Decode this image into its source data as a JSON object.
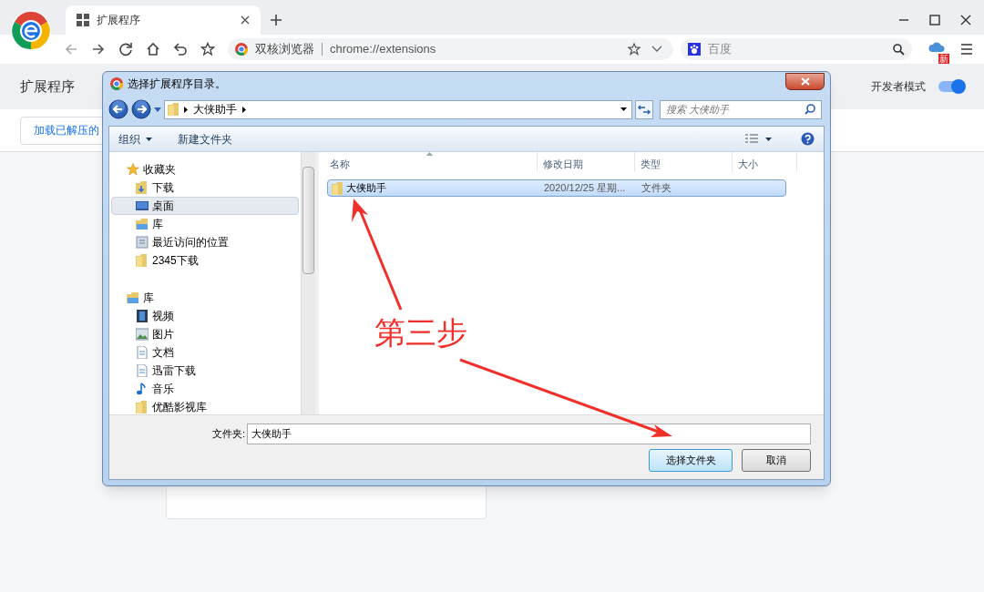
{
  "browser": {
    "tab": {
      "title": "扩展程序",
      "selected": true
    },
    "address": {
      "site_label": "双核浏览器",
      "url": "chrome://extensions"
    },
    "search": {
      "placeholder": "百度"
    },
    "extension_badge": "新"
  },
  "page": {
    "title": "扩展程序",
    "developer_mode": {
      "label": "开发者模式",
      "on": true
    },
    "load_button": "加载已解压的"
  },
  "dialog": {
    "title": "选择扩展程序目录。",
    "breadcrumb": [
      "大侠助手"
    ],
    "search": {
      "placeholder": "搜索 大侠助手"
    },
    "toolbar": [
      {
        "label": "组织",
        "kind": "menu"
      },
      {
        "label": "新建文件夹",
        "kind": "button"
      }
    ],
    "nav": [
      {
        "label": "收藏夹",
        "kind": "star",
        "selected": false,
        "children": [
          {
            "label": "下载",
            "kind": "download",
            "selected": false
          },
          {
            "label": "桌面",
            "kind": "desktop",
            "selected": true
          },
          {
            "label": "库",
            "kind": "library",
            "selected": false
          },
          {
            "label": "最近访问的位置",
            "kind": "recent",
            "selected": false
          },
          {
            "label": "2345下载",
            "kind": "folder",
            "selected": false
          }
        ]
      },
      {
        "label": "库",
        "kind": "library",
        "selected": false,
        "children": [
          {
            "label": "视频",
            "kind": "video",
            "selected": false
          },
          {
            "label": "图片",
            "kind": "picture",
            "selected": false
          },
          {
            "label": "文档",
            "kind": "document",
            "selected": false
          },
          {
            "label": "迅雷下载",
            "kind": "document",
            "selected": false
          },
          {
            "label": "音乐",
            "kind": "music",
            "selected": false
          },
          {
            "label": "优酷影视库",
            "kind": "folder",
            "selected": false
          }
        ]
      }
    ],
    "columns": [
      "名称",
      "修改日期",
      "类型",
      "大小"
    ],
    "rows": [
      {
        "cells": [
          "大侠助手",
          "2020/12/25 星期...",
          "文件夹"
        ],
        "selected": true
      }
    ],
    "folder_label": "文件夹:",
    "folder_value": "大侠助手",
    "buttons": [
      {
        "label": "选择文件夹",
        "kind": "primary"
      },
      {
        "label": "取消",
        "kind": "default"
      }
    ]
  },
  "annotation": {
    "text": "第三步"
  }
}
